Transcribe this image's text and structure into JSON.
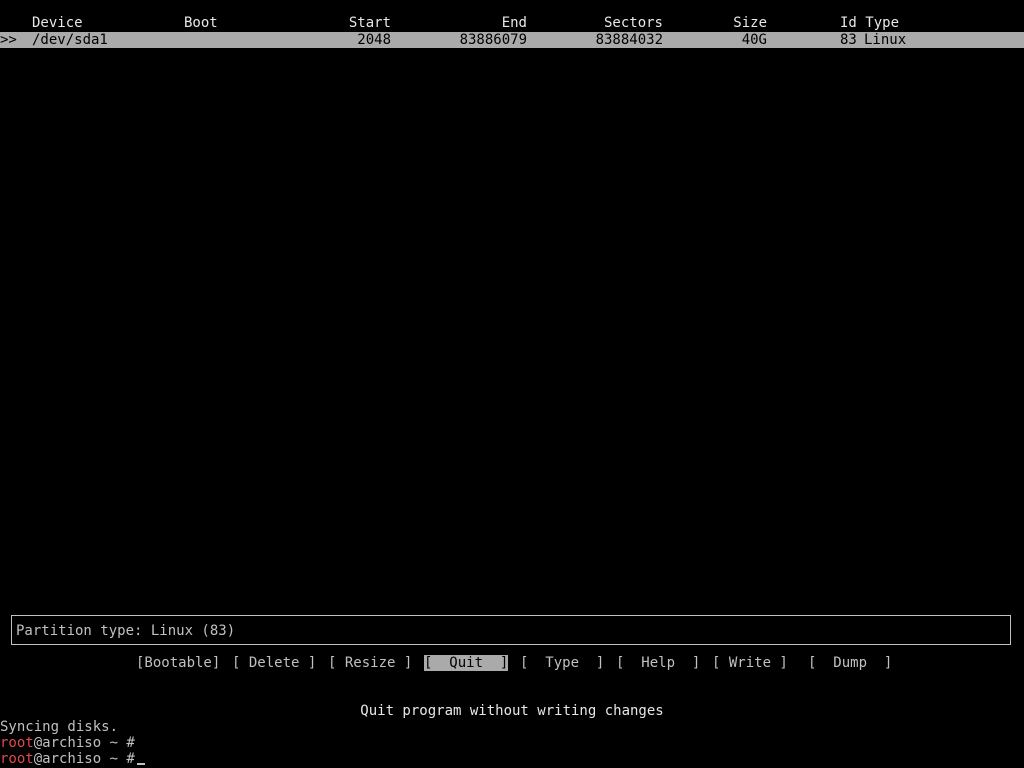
{
  "table": {
    "headers": {
      "device": "Device",
      "boot": "Boot",
      "start": "Start",
      "end": "End",
      "sectors": "Sectors",
      "size": "Size",
      "id_type": "Id Type"
    },
    "rows": [
      {
        "marker": ">>",
        "device": "/dev/sda1",
        "boot": "",
        "start": "2048",
        "end": "83886079",
        "sectors": "83884032",
        "size": "40G",
        "id": "83",
        "type": "Linux"
      }
    ]
  },
  "info": {
    "partition_type": "Partition type: Linux (83)"
  },
  "menu": {
    "items": [
      {
        "label": "[Bootable]",
        "selected": false
      },
      {
        "label": "[ Delete ]",
        "selected": false
      },
      {
        "label": "[ Resize ]",
        "selected": false
      },
      {
        "label": "[  Quit  ]",
        "selected": true
      },
      {
        "label": "[  Type  ]",
        "selected": false
      },
      {
        "label": "[  Help  ]",
        "selected": false
      },
      {
        "label": "[ Write ]",
        "selected": false
      },
      {
        "label": "[  Dump  ]",
        "selected": false
      }
    ]
  },
  "status": {
    "hint": "Quit program without writing changes"
  },
  "terminal": {
    "lines": [
      "Syncing disks."
    ],
    "prompt_user": "root",
    "prompt_rest": "@archiso ~ #"
  },
  "colors": {
    "background": "#000000",
    "text": "#c0c0c0",
    "highlight": "#aaaaaa",
    "prompt_user": "#e04848"
  }
}
